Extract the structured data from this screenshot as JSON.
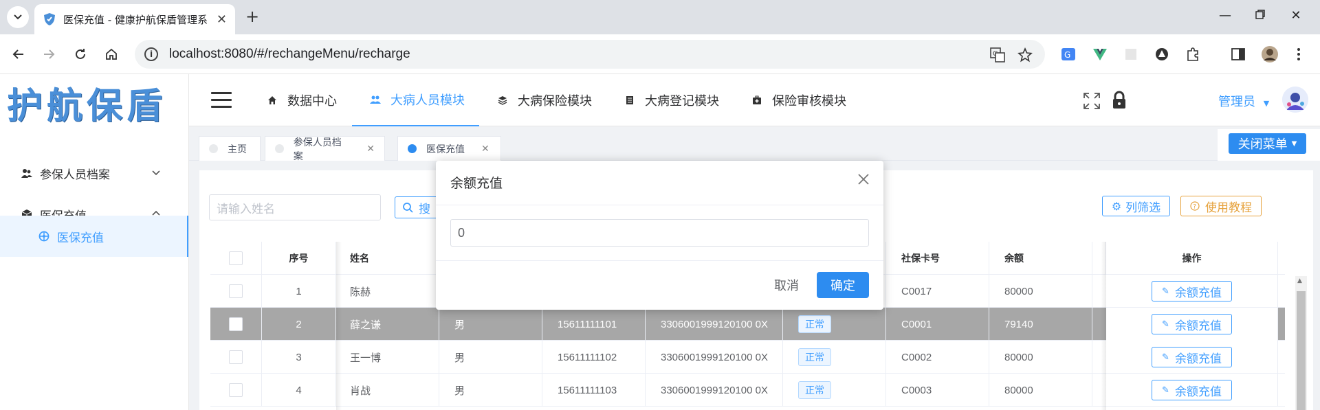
{
  "browser": {
    "tab_title": "医保充值 - 健康护航保盾管理系",
    "url": "localhost:8080/#/rechangeMenu/recharge"
  },
  "sidebar": {
    "logo_text": "护航保盾",
    "items": [
      {
        "label": "参保人员档案",
        "icon": "users-icon",
        "expanded": false
      },
      {
        "label": "医保充值",
        "icon": "cube-icon",
        "expanded": true
      },
      {
        "label": "医保充值",
        "icon": "aperture-icon",
        "active": true
      }
    ]
  },
  "topnav": {
    "tabs": [
      {
        "label": "数据中心",
        "icon": "home-icon"
      },
      {
        "label": "大病人员模块",
        "icon": "people-icon",
        "active": true
      },
      {
        "label": "大病保险模块",
        "icon": "layers-icon"
      },
      {
        "label": "大病登记模块",
        "icon": "notebook-icon"
      },
      {
        "label": "保险审核模块",
        "icon": "medkit-icon"
      }
    ],
    "user": "管理员"
  },
  "tags": [
    {
      "label": "主页",
      "closable": false
    },
    {
      "label": "参保人员档案",
      "closable": true
    },
    {
      "label": "医保充值",
      "closable": true,
      "active": true
    }
  ],
  "close_menu_label": "关闭菜单",
  "toolbar": {
    "search_placeholder": "请输入姓名",
    "search_label": "搜",
    "column_filter_label": "列筛选",
    "tutorial_label": "使用教程"
  },
  "table": {
    "headers": [
      "序号",
      "姓名",
      "社保卡号",
      "余额",
      "操作"
    ],
    "rows": [
      {
        "no": "1",
        "name": "陈赫",
        "gender": "",
        "phone": "",
        "idcard": "",
        "status": "",
        "card": "C0017",
        "balance": "80000"
      },
      {
        "no": "2",
        "name": "薛之谦",
        "gender": "男",
        "phone": "15611111101",
        "idcard": "3306001999120100 0X",
        "status": "正常",
        "card": "C0001",
        "balance": "79140"
      },
      {
        "no": "3",
        "name": "王一博",
        "gender": "男",
        "phone": "15611111102",
        "idcard": "3306001999120100 0X",
        "status": "正常",
        "card": "C0002",
        "balance": "80000"
      },
      {
        "no": "4",
        "name": "肖战",
        "gender": "男",
        "phone": "15611111103",
        "idcard": "3306001999120100 0X",
        "status": "正常",
        "card": "C0003",
        "balance": "80000"
      }
    ],
    "action_label": "余额充值"
  },
  "modal": {
    "title": "余额充值",
    "value": "0",
    "cancel_label": "取消",
    "ok_label": "确定"
  }
}
